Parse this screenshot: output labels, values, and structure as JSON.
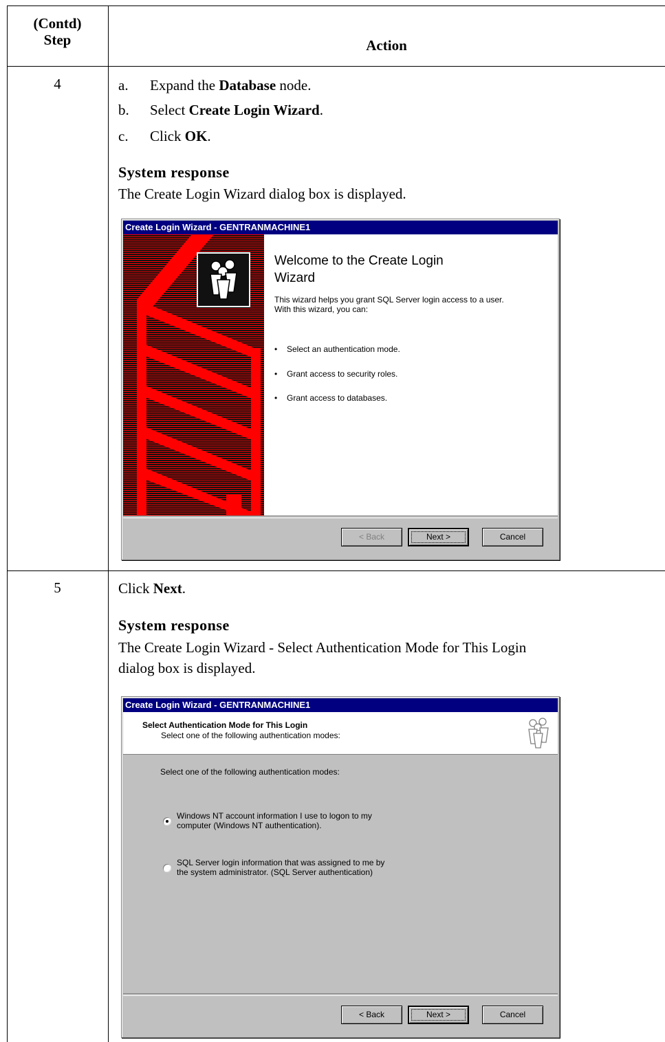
{
  "table": {
    "header": {
      "step_line1": "(Contd)",
      "step_line2": "Step",
      "action": "Action"
    }
  },
  "step4": {
    "number": "4",
    "items": [
      {
        "letter": "a.",
        "pre": "Expand the ",
        "bold": "Database",
        "post": " node."
      },
      {
        "letter": "b.",
        "pre": "Select ",
        "bold": "Create Login Wizard",
        "post": "."
      },
      {
        "letter": "c.",
        "pre": "Click ",
        "bold": "OK",
        "post": "."
      }
    ],
    "system_response_label": "System response",
    "system_response_text": "The Create Login Wizard dialog box is displayed."
  },
  "dialog1": {
    "title": "Create Login Wizard - GENTRANMACHINE1",
    "heading": "Welcome to the Create Login Wizard",
    "intro_line1": "This wizard helps you grant SQL Server login access to a user.",
    "intro_line2": "With this wizard, you can:",
    "bullets": [
      "Select an authentication mode.",
      "Grant access to security roles.",
      "Grant access to databases."
    ],
    "buttons": {
      "back": "< Back",
      "next": "Next >",
      "cancel": "Cancel"
    },
    "colors": {
      "banner": "#ff0000",
      "titlebar": "#000080"
    }
  },
  "step5": {
    "number": "5",
    "pre": "Click ",
    "bold": "Next",
    "post": ".",
    "system_response_label": "System response",
    "system_response_line1": "The Create Login Wizard - Select Authentication Mode for This Login",
    "system_response_line2": "dialog box is displayed."
  },
  "dialog2": {
    "title": "Create Login Wizard - GENTRANMACHINE1",
    "header_title": "Select Authentication Mode for This Login",
    "header_subtitle": "Select one of the following authentication modes:",
    "prompt": "Select one of the following authentication modes:",
    "options": [
      {
        "line1": "Windows NT account information I use to logon to my",
        "line2": "computer (Windows NT authentication).",
        "selected": true
      },
      {
        "line1": "SQL Server login information that was assigned to me by",
        "line2": "the system administrator. (SQL Server authentication)",
        "selected": false
      }
    ],
    "buttons": {
      "back": "< Back",
      "next": "Next >",
      "cancel": "Cancel"
    }
  }
}
